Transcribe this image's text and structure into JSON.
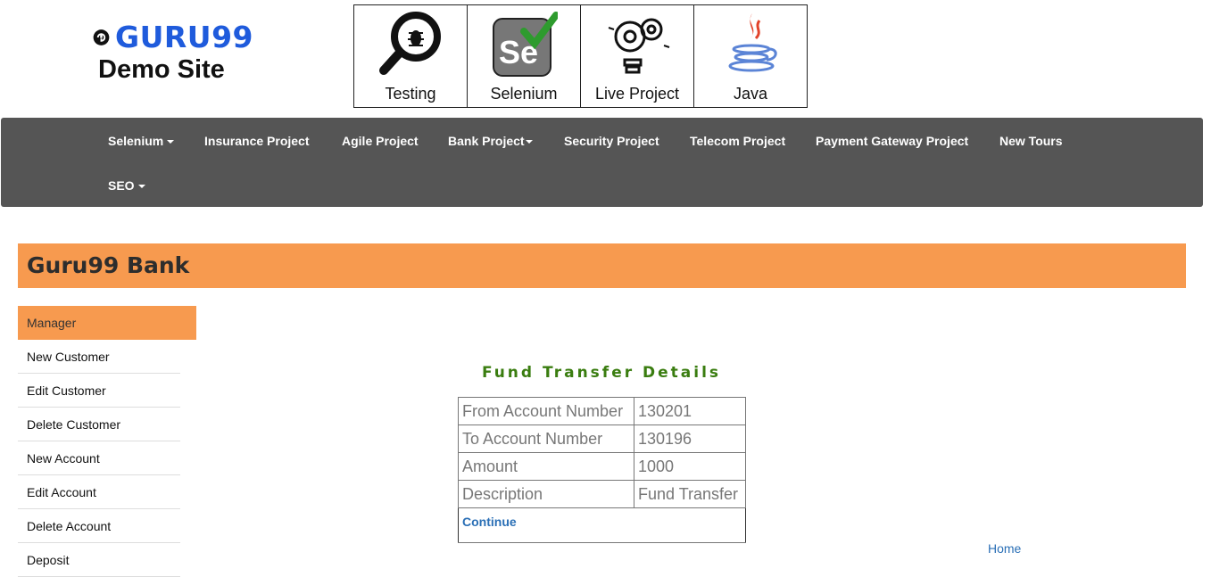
{
  "brand": {
    "logo_text": "GURU99",
    "subtitle": "Demo Site",
    "logo_color": "#1f5bdc"
  },
  "tiles": [
    {
      "label": "Testing",
      "icon": "magnifier-bug-icon"
    },
    {
      "label": "Selenium",
      "icon": "selenium-icon"
    },
    {
      "label": "Live Project",
      "icon": "lightbulb-gears-icon"
    },
    {
      "label": "Java",
      "icon": "java-cup-icon"
    }
  ],
  "nav": {
    "items": [
      {
        "label": "Selenium",
        "dropdown": true
      },
      {
        "label": "Insurance Project",
        "dropdown": false
      },
      {
        "label": "Agile Project",
        "dropdown": false
      },
      {
        "label": "Bank Project",
        "dropdown": true
      },
      {
        "label": "Security Project",
        "dropdown": false
      },
      {
        "label": "Telecom Project",
        "dropdown": false
      },
      {
        "label": "Payment Gateway Project",
        "dropdown": false
      },
      {
        "label": "New Tours",
        "dropdown": false
      },
      {
        "label": "SEO",
        "dropdown": true
      }
    ],
    "background": "#555555"
  },
  "bank": {
    "title": "Guru99 Bank",
    "header_color": "#f79a4f"
  },
  "sidebar": {
    "items": [
      {
        "label": "Manager",
        "active": true
      },
      {
        "label": "New Customer"
      },
      {
        "label": "Edit Customer"
      },
      {
        "label": "Delete Customer"
      },
      {
        "label": "New Account"
      },
      {
        "label": "Edit Account"
      },
      {
        "label": "Delete Account"
      },
      {
        "label": "Deposit"
      }
    ]
  },
  "details": {
    "title": "Fund Transfer Details",
    "rows": [
      {
        "label": "From Account Number",
        "value": "130201"
      },
      {
        "label": "To Account Number",
        "value": "130196"
      },
      {
        "label": "Amount",
        "value": "1000"
      },
      {
        "label": "Description",
        "value": "Fund Transfer"
      }
    ],
    "continue_label": "Continue"
  },
  "footer": {
    "home_label": "Home"
  }
}
